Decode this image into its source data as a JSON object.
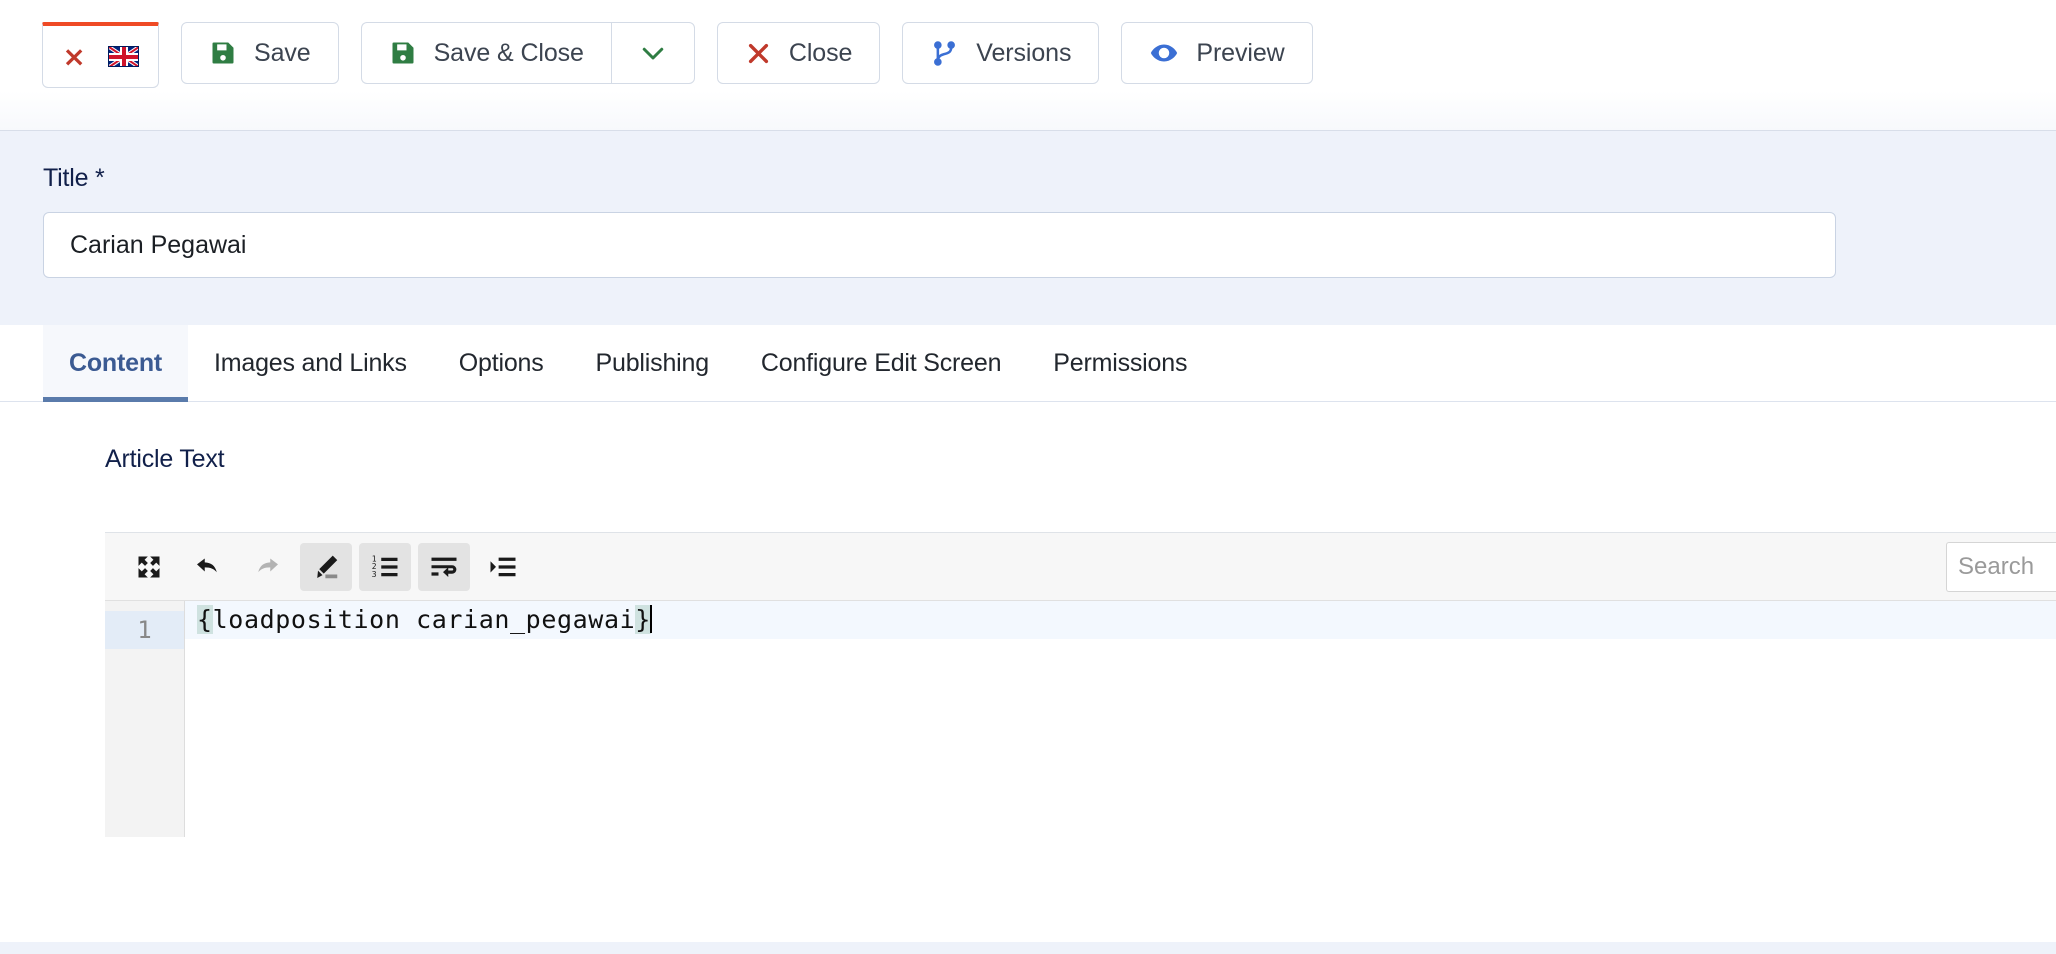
{
  "toolbar": {
    "language_button": {
      "name": "language-switcher",
      "close_glyph": "×",
      "flag": "uk-flag-icon"
    },
    "buttons": [
      {
        "label": "Save",
        "icon": "save-icon"
      },
      {
        "label": "Save & Close",
        "icon": "save-icon"
      },
      {
        "label": "Close",
        "icon": "close-x-icon"
      },
      {
        "label": "Versions",
        "icon": "git-branch-icon"
      },
      {
        "label": "Preview",
        "icon": "eye-icon"
      }
    ],
    "caret_icon": "chevron-down-icon"
  },
  "form": {
    "title_label": "Title *",
    "title_value": "Carian Pegawai",
    "title_placeholder": ""
  },
  "tabs": [
    {
      "label": "Content",
      "active": true
    },
    {
      "label": "Images and Links",
      "active": false
    },
    {
      "label": "Options",
      "active": false
    },
    {
      "label": "Publishing",
      "active": false
    },
    {
      "label": "Configure Edit Screen",
      "active": false
    },
    {
      "label": "Permissions",
      "active": false
    }
  ],
  "editor": {
    "section_label": "Article Text",
    "toolbar_buttons": [
      {
        "name": "fullscreen-icon",
        "active": false
      },
      {
        "name": "undo-icon",
        "active": false
      },
      {
        "name": "redo-icon",
        "active": false
      },
      {
        "name": "marker-pencil-icon",
        "active": true
      },
      {
        "name": "numbered-list-icon",
        "active": true
      },
      {
        "name": "word-wrap-icon",
        "active": true
      },
      {
        "name": "indent-icon",
        "active": false
      }
    ],
    "search_placeholder": "Search",
    "search_value": "",
    "line_number": "1",
    "code_open_brace": "{",
    "code_body": "loadposition carian_pegawai",
    "code_close_brace": "}"
  },
  "colors": {
    "accent_blue": "#3b5a92",
    "save_green": "#2f7d43",
    "danger_red": "#c0392b",
    "link_blue": "#3b6fd4",
    "lang_underline": "#ef4a25",
    "page_bg": "#eef2fa"
  }
}
